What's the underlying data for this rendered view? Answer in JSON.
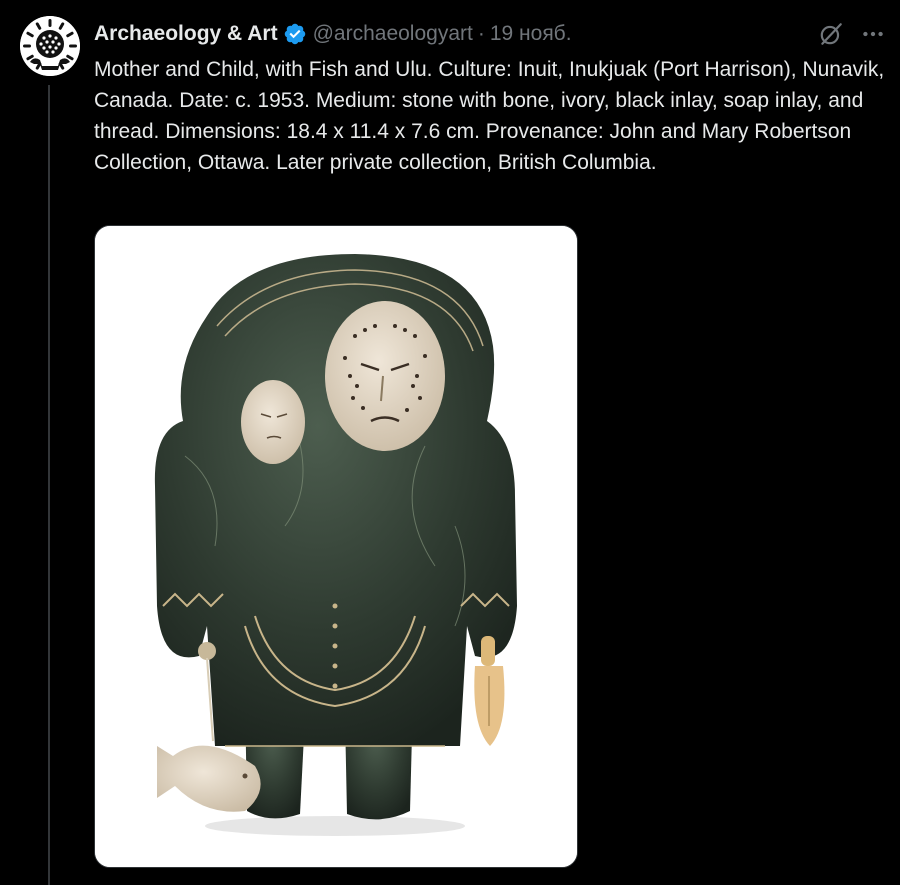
{
  "post": {
    "author_name": "Archaeology & Art",
    "handle": "@archaeologyart",
    "separator": "·",
    "date": "19 нояб.",
    "text": "Mother and Child, with Fish and Ulu. Culture: Inuit, Inukjuak (Port Harrison), Nunavik, Canada. Date: c. 1953. Medium: stone with bone, ivory, black inlay, soap inlay, and thread. Dimensions: 18.4 x 11.4 x 7.6 cm. Provenance: John and Mary Robertson Collection, Ottawa. Later private collection, British Columbia."
  },
  "icons": {
    "avatar": "logo-avatar",
    "verified": "verified-badge-icon",
    "grok": "grok-icon",
    "more": "more-icon"
  },
  "colors": {
    "background": "#000000",
    "text_primary": "#e7e9ea",
    "text_secondary": "#71767b",
    "verified_blue": "#1d9bf0",
    "divider": "#333639"
  }
}
